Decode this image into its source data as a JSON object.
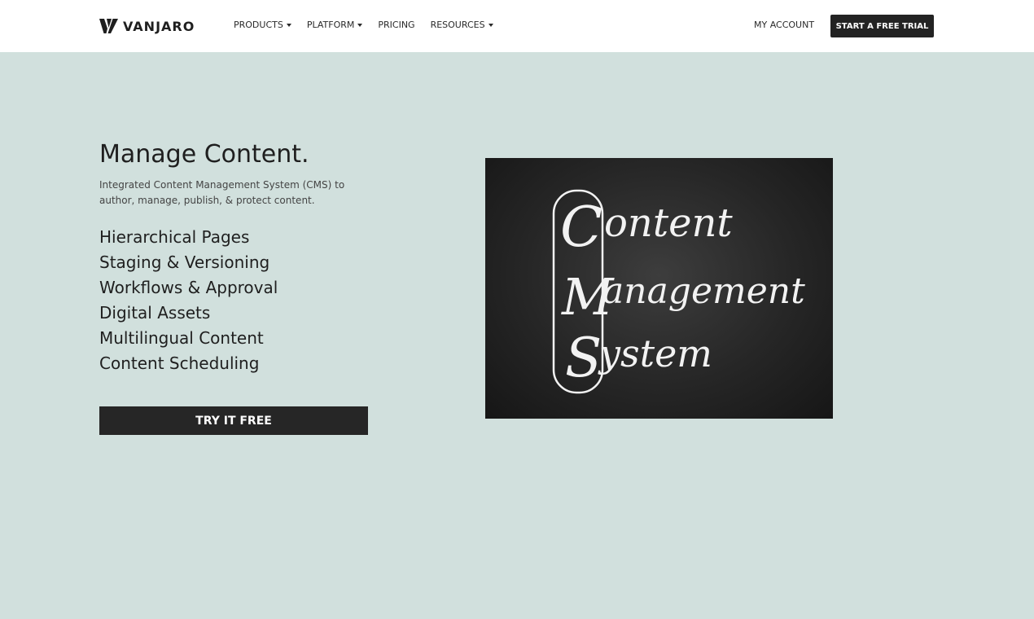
{
  "header": {
    "brand": "VANJARO",
    "nav": [
      {
        "label": "PRODUCTS",
        "dropdown": true
      },
      {
        "label": "PLATFORM",
        "dropdown": true
      },
      {
        "label": "PRICING",
        "dropdown": false
      },
      {
        "label": "RESOURCES",
        "dropdown": true
      }
    ],
    "account_label": "MY ACCOUNT",
    "trial_label": "START A FREE TRIAL"
  },
  "hero": {
    "title": "Manage Content.",
    "subtitle": "Integrated Content Management System (CMS) to author, manage, publish, & protect content.",
    "features": [
      "Hierarchical Pages",
      "Staging & Versioning",
      "Workflows & Approval",
      "Digital Assets",
      "Multilingual Content",
      "Content Scheduling"
    ],
    "cta_label": "TRY IT FREE",
    "image_text": {
      "line1_initial": "C",
      "line1_rest": "ontent",
      "line2_initial": "M",
      "line2_rest": "anagement",
      "line3_initial": "S",
      "line3_rest": "ystem"
    }
  },
  "colors": {
    "background": "#d1e0dd",
    "header_bg": "#ffffff",
    "button_dark": "#232323",
    "chalkboard": "#262626",
    "chalk": "#f2f2f2"
  }
}
